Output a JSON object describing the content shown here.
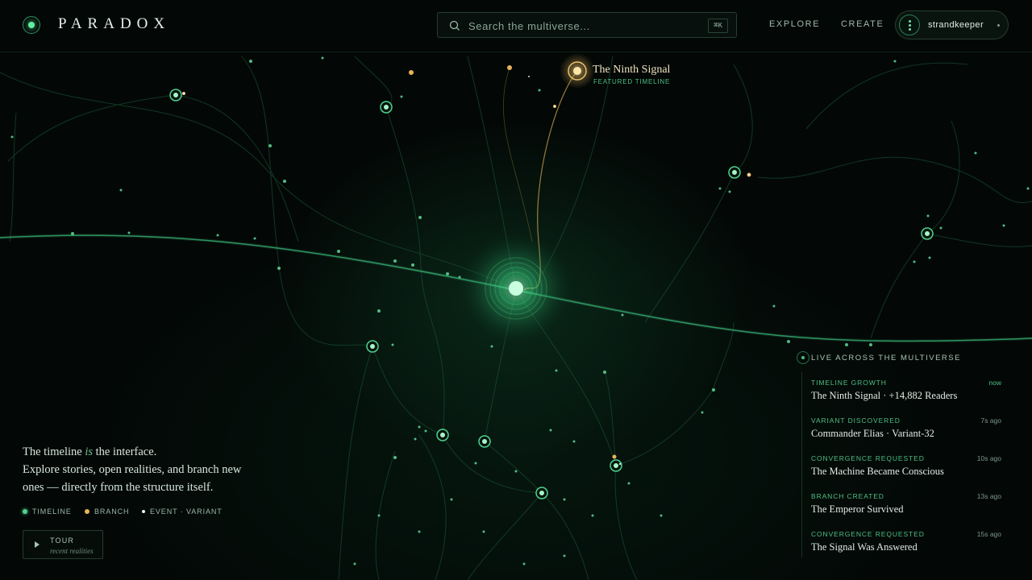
{
  "brand": {
    "name": "PARADOX"
  },
  "search": {
    "placeholder": "Search the multiverse...",
    "shortcut": "⌘K"
  },
  "nav": {
    "explore": "EXPLORE",
    "create": "CREATE"
  },
  "user": {
    "name": "strandkeeper"
  },
  "featured": {
    "title": "The Ninth Signal",
    "subtitle": "FEATURED TIMELINE"
  },
  "intro": {
    "line1_pre": "The timeline ",
    "line1_em": "is",
    "line1_post": " the interface.",
    "line2": "Explore stories, open realities, and branch new",
    "line3": "ones — directly from the structure itself."
  },
  "legend": {
    "timeline": "TIMELINE",
    "branch": "BRANCH",
    "event": "EVENT · VARIANT",
    "colors": {
      "timeline": "#4fd18e",
      "branch": "#e8b45a",
      "event": "#f1efe6"
    }
  },
  "tour": {
    "label": "TOUR",
    "sub": "recent realities"
  },
  "live": {
    "heading": "LIVE ACROSS THE MULTIVERSE",
    "items": [
      {
        "type": "TIMELINE GROWTH",
        "title": "The Ninth Signal · +14,882 Readers",
        "time": "now"
      },
      {
        "type": "VARIANT DISCOVERED",
        "title": "Commander Elias · Variant-32",
        "time": "7s ago"
      },
      {
        "type": "CONVERGENCE REQUESTED",
        "title": "The Machine Became Conscious",
        "time": "10s ago"
      },
      {
        "type": "BRANCH CREATED",
        "title": "The Emperor Survived",
        "time": "13s ago"
      },
      {
        "type": "CONVERGENCE REQUESTED",
        "title": "The Signal Was Answered",
        "time": "15s ago"
      }
    ]
  },
  "colors": {
    "accent": "#4fd18e",
    "gold": "#e8b45a",
    "background": "#030806"
  }
}
